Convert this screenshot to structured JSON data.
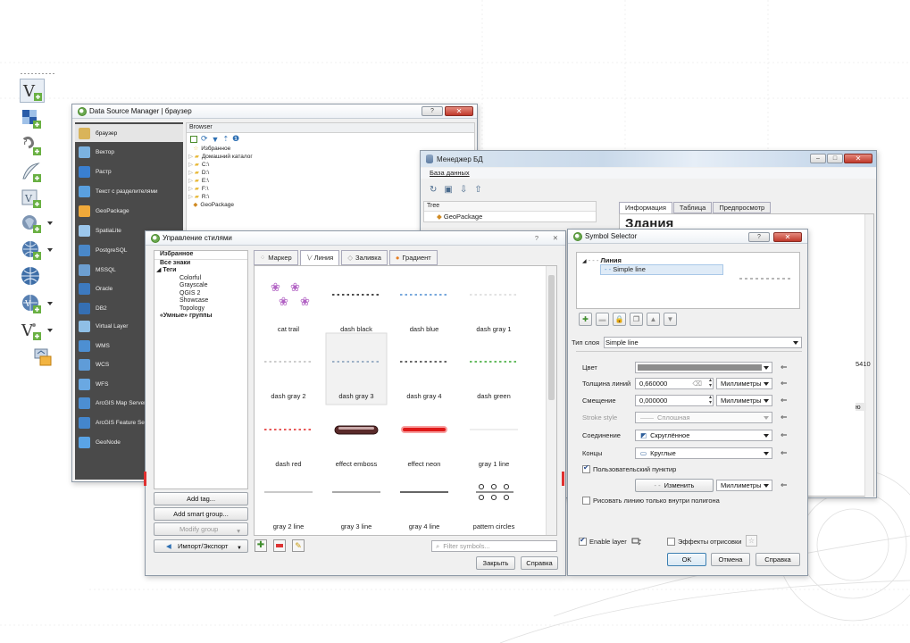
{
  "toolbar": {
    "icons": [
      "vector-new-icon",
      "raster-icon",
      "open-vector-icon",
      "digitize-icon",
      "virtual-layer-icon",
      "database-icon",
      "wms-icon",
      "wfs-icon",
      "wcs-icon",
      "vertex-tool-icon",
      "processing-icon"
    ]
  },
  "dsm": {
    "title": "Data Source Manager | браузер",
    "panel_header": "Browser",
    "providers": [
      "браузер",
      "Вектор",
      "Растр",
      "Текст с разделителями",
      "GeoPackage",
      "SpatiaLite",
      "PostgreSQL",
      "MSSQL",
      "Oracle",
      "DB2",
      "Virtual Layer",
      "WMS",
      "WCS",
      "WFS",
      "ArcGIS Map Server",
      "ArcGIS Feature Serve",
      "GeoNode"
    ],
    "tree": [
      "Избранное",
      "Домашний каталог",
      "C:\\",
      "D:\\",
      "E:\\",
      "F:\\",
      "R:\\",
      "GeoPackage"
    ]
  },
  "dbm": {
    "title": "Менеджер БД",
    "menu": "База данных",
    "tree_header": "Tree",
    "tree_item": "GeoPackage",
    "tabs": [
      "Информация",
      "Таблица",
      "Предпросмотр"
    ],
    "heading": "Здания",
    "side_value": "5410",
    "side_value2": "ю"
  },
  "style": {
    "title": "Управление стилями",
    "left_tree": [
      "Избранное",
      "Все знаки",
      "Теги",
      "Colorful",
      "Grayscale",
      "QGIS 2",
      "Showcase",
      "Topology",
      "«Умные» группы"
    ],
    "tabs": [
      "Маркер",
      "Линия",
      "Заливка",
      "Градиент"
    ],
    "symbols": [
      {
        "name": "cat trail",
        "kind": "cat"
      },
      {
        "name": "dash  black",
        "kind": "dash",
        "color": "#111111"
      },
      {
        "name": "dash blue",
        "kind": "dash",
        "color": "#4a8bd1"
      },
      {
        "name": "dash gray 1",
        "kind": "dash",
        "color": "#d8d8d8"
      },
      {
        "name": "dash gray 2",
        "kind": "dash",
        "color": "#bcbcbc"
      },
      {
        "name": "dash gray 3",
        "kind": "dash",
        "color": "#7f9ab8"
      },
      {
        "name": "dash gray 4",
        "kind": "dash",
        "color": "#333333"
      },
      {
        "name": "dash green",
        "kind": "dash",
        "color": "#33a52b"
      },
      {
        "name": "dash red",
        "kind": "dash",
        "color": "#e02020"
      },
      {
        "name": "effect emboss",
        "kind": "emboss"
      },
      {
        "name": "effect neon",
        "kind": "neon"
      },
      {
        "name": "gray 1 line",
        "kind": "solid",
        "color": "#e8e8e8"
      },
      {
        "name": "gray 2 line",
        "kind": "solid",
        "color": "#b8b8b8"
      },
      {
        "name": "gray 3 line",
        "kind": "solid",
        "color": "#8c8c8c"
      },
      {
        "name": "gray 4 line",
        "kind": "solid",
        "color": "#333333"
      },
      {
        "name": "pattern circles",
        "kind": "circles"
      }
    ],
    "add_tag": "Add tag...",
    "add_smart_group": "Add smart group...",
    "modify_group": "Modify group",
    "import_export": "Импорт/Экспорт",
    "filter_placeholder": "Filter symbols...",
    "close": "Закрыть",
    "help": "Справка"
  },
  "selector": {
    "title": "Symbol Selector",
    "tree_root": "Линия",
    "tree_child": "Simple line",
    "layer_type_label": "Тип слоя",
    "layer_type_value": "Simple line",
    "color_label": "Цвет",
    "width_label": "Толщина линий",
    "width_value": "0,660000",
    "width_unit": "Миллиметры",
    "offset_label": "Смещение",
    "offset_value": "0,000000",
    "offset_unit": "Миллиметры",
    "stroke_label": "Stroke style",
    "stroke_value": "Сплошная",
    "join_label": "Соединение",
    "join_value": "Скруглённое",
    "cap_label": "Концы",
    "cap_value": "Круглые",
    "custom_dash_label": "Пользовательский пунктир",
    "custom_dash_checked": true,
    "change_label": "Изменить",
    "dash_unit": "Миллиметры",
    "inside_polygon_label": "Рисовать линию только внутри полигона",
    "inside_polygon_checked": false,
    "enable_layer_label": "Enable layer",
    "enable_layer_checked": true,
    "effects_label": "Эффекты отрисовки",
    "effects_checked": false,
    "ok": "OK",
    "cancel": "Отмена",
    "help": "Справка",
    "accent": "#c0392b",
    "line_color": "#8c8c8c"
  }
}
